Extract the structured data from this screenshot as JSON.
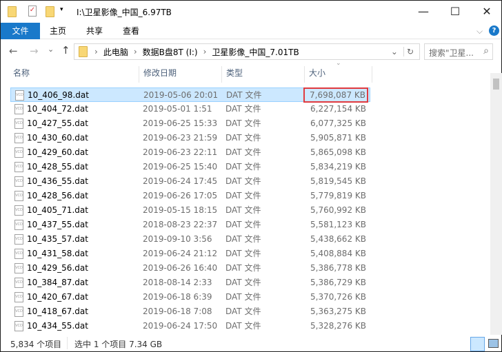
{
  "window": {
    "title": "I:\\卫星影像_中国_6.97TB",
    "minimize": "—",
    "maximize": "☐",
    "close": "✕"
  },
  "ribbon": {
    "tabs": [
      "文件",
      "主页",
      "共享",
      "查看"
    ],
    "help": "?",
    "expand": "⌵"
  },
  "nav": {
    "back": "←",
    "forward": "→",
    "recent": "⌄",
    "up": "↑",
    "refresh": "↻",
    "dropdown": "⌄"
  },
  "address": {
    "crumbs": [
      "此电脑",
      "数据B盘8T (I:)",
      "卫星影像_中国_7.01TB"
    ],
    "sep": "›"
  },
  "search": {
    "placeholder": "搜索\"卫星...",
    "icon": "⌕"
  },
  "columns": {
    "name": "名称",
    "date": "修改日期",
    "type": "类型",
    "size": "大小",
    "sort": "⌄"
  },
  "files": [
    {
      "name": "10_406_98.dat",
      "date": "2019-05-06 20:01",
      "type": "DAT 文件",
      "size": "7,698,087 KB",
      "selected": true
    },
    {
      "name": "10_404_72.dat",
      "date": "2019-05-01 1:51",
      "type": "DAT 文件",
      "size": "6,227,154 KB"
    },
    {
      "name": "10_427_55.dat",
      "date": "2019-06-25 15:33",
      "type": "DAT 文件",
      "size": "6,077,325 KB"
    },
    {
      "name": "10_430_60.dat",
      "date": "2019-06-23 21:59",
      "type": "DAT 文件",
      "size": "5,905,871 KB"
    },
    {
      "name": "10_429_60.dat",
      "date": "2019-06-23 22:11",
      "type": "DAT 文件",
      "size": "5,865,098 KB"
    },
    {
      "name": "10_428_55.dat",
      "date": "2019-06-25 15:40",
      "type": "DAT 文件",
      "size": "5,834,219 KB"
    },
    {
      "name": "10_436_55.dat",
      "date": "2019-06-24 17:45",
      "type": "DAT 文件",
      "size": "5,819,545 KB"
    },
    {
      "name": "10_428_56.dat",
      "date": "2019-06-26 17:05",
      "type": "DAT 文件",
      "size": "5,779,819 KB"
    },
    {
      "name": "10_405_71.dat",
      "date": "2019-05-15 18:15",
      "type": "DAT 文件",
      "size": "5,760,992 KB"
    },
    {
      "name": "10_437_55.dat",
      "date": "2018-08-23 22:37",
      "type": "DAT 文件",
      "size": "5,581,123 KB"
    },
    {
      "name": "10_435_57.dat",
      "date": "2019-09-10 3:56",
      "type": "DAT 文件",
      "size": "5,438,662 KB"
    },
    {
      "name": "10_431_58.dat",
      "date": "2019-06-24 21:12",
      "type": "DAT 文件",
      "size": "5,408,884 KB"
    },
    {
      "name": "10_429_56.dat",
      "date": "2019-06-26 16:40",
      "type": "DAT 文件",
      "size": "5,386,778 KB"
    },
    {
      "name": "10_384_87.dat",
      "date": "2018-08-14 2:33",
      "type": "DAT 文件",
      "size": "5,386,729 KB"
    },
    {
      "name": "10_420_67.dat",
      "date": "2019-06-18 6:39",
      "type": "DAT 文件",
      "size": "5,370,726 KB"
    },
    {
      "name": "10_418_67.dat",
      "date": "2019-06-18 7:08",
      "type": "DAT 文件",
      "size": "5,363,275 KB"
    },
    {
      "name": "10_434_55.dat",
      "date": "2019-06-24 17:50",
      "type": "DAT 文件",
      "size": "5,328,276 KB"
    }
  ],
  "status": {
    "count": "5,834 个项目",
    "selection": "选中 1 个项目  7.34 GB"
  },
  "colors": {
    "accent": "#1979ca",
    "selection": "#cce8ff",
    "highlight": "#e0393e"
  }
}
